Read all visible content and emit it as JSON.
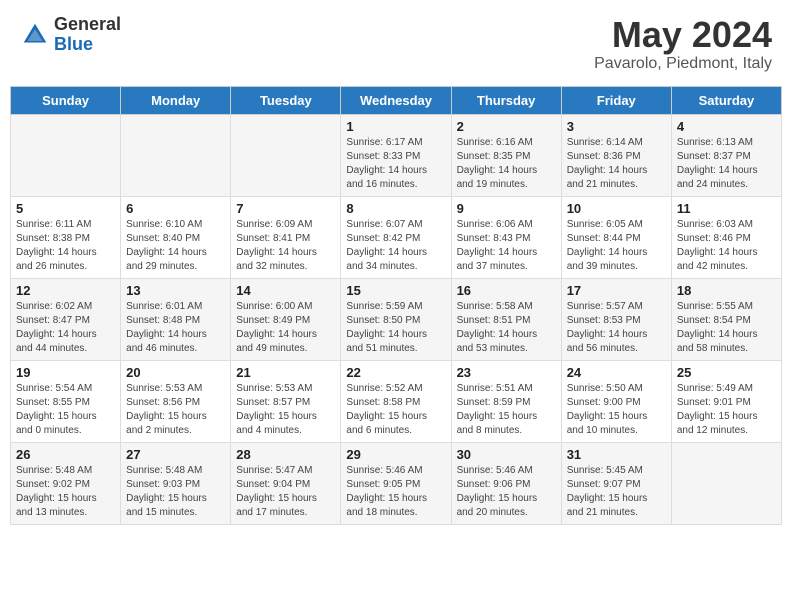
{
  "header": {
    "logo_general": "General",
    "logo_blue": "Blue",
    "month_title": "May 2024",
    "location": "Pavarolo, Piedmont, Italy"
  },
  "days_of_week": [
    "Sunday",
    "Monday",
    "Tuesday",
    "Wednesday",
    "Thursday",
    "Friday",
    "Saturday"
  ],
  "weeks": [
    [
      {
        "day": "",
        "info": ""
      },
      {
        "day": "",
        "info": ""
      },
      {
        "day": "",
        "info": ""
      },
      {
        "day": "1",
        "info": "Sunrise: 6:17 AM\nSunset: 8:33 PM\nDaylight: 14 hours\nand 16 minutes."
      },
      {
        "day": "2",
        "info": "Sunrise: 6:16 AM\nSunset: 8:35 PM\nDaylight: 14 hours\nand 19 minutes."
      },
      {
        "day": "3",
        "info": "Sunrise: 6:14 AM\nSunset: 8:36 PM\nDaylight: 14 hours\nand 21 minutes."
      },
      {
        "day": "4",
        "info": "Sunrise: 6:13 AM\nSunset: 8:37 PM\nDaylight: 14 hours\nand 24 minutes."
      }
    ],
    [
      {
        "day": "5",
        "info": "Sunrise: 6:11 AM\nSunset: 8:38 PM\nDaylight: 14 hours\nand 26 minutes."
      },
      {
        "day": "6",
        "info": "Sunrise: 6:10 AM\nSunset: 8:40 PM\nDaylight: 14 hours\nand 29 minutes."
      },
      {
        "day": "7",
        "info": "Sunrise: 6:09 AM\nSunset: 8:41 PM\nDaylight: 14 hours\nand 32 minutes."
      },
      {
        "day": "8",
        "info": "Sunrise: 6:07 AM\nSunset: 8:42 PM\nDaylight: 14 hours\nand 34 minutes."
      },
      {
        "day": "9",
        "info": "Sunrise: 6:06 AM\nSunset: 8:43 PM\nDaylight: 14 hours\nand 37 minutes."
      },
      {
        "day": "10",
        "info": "Sunrise: 6:05 AM\nSunset: 8:44 PM\nDaylight: 14 hours\nand 39 minutes."
      },
      {
        "day": "11",
        "info": "Sunrise: 6:03 AM\nSunset: 8:46 PM\nDaylight: 14 hours\nand 42 minutes."
      }
    ],
    [
      {
        "day": "12",
        "info": "Sunrise: 6:02 AM\nSunset: 8:47 PM\nDaylight: 14 hours\nand 44 minutes."
      },
      {
        "day": "13",
        "info": "Sunrise: 6:01 AM\nSunset: 8:48 PM\nDaylight: 14 hours\nand 46 minutes."
      },
      {
        "day": "14",
        "info": "Sunrise: 6:00 AM\nSunset: 8:49 PM\nDaylight: 14 hours\nand 49 minutes."
      },
      {
        "day": "15",
        "info": "Sunrise: 5:59 AM\nSunset: 8:50 PM\nDaylight: 14 hours\nand 51 minutes."
      },
      {
        "day": "16",
        "info": "Sunrise: 5:58 AM\nSunset: 8:51 PM\nDaylight: 14 hours\nand 53 minutes."
      },
      {
        "day": "17",
        "info": "Sunrise: 5:57 AM\nSunset: 8:53 PM\nDaylight: 14 hours\nand 56 minutes."
      },
      {
        "day": "18",
        "info": "Sunrise: 5:55 AM\nSunset: 8:54 PM\nDaylight: 14 hours\nand 58 minutes."
      }
    ],
    [
      {
        "day": "19",
        "info": "Sunrise: 5:54 AM\nSunset: 8:55 PM\nDaylight: 15 hours\nand 0 minutes."
      },
      {
        "day": "20",
        "info": "Sunrise: 5:53 AM\nSunset: 8:56 PM\nDaylight: 15 hours\nand 2 minutes."
      },
      {
        "day": "21",
        "info": "Sunrise: 5:53 AM\nSunset: 8:57 PM\nDaylight: 15 hours\nand 4 minutes."
      },
      {
        "day": "22",
        "info": "Sunrise: 5:52 AM\nSunset: 8:58 PM\nDaylight: 15 hours\nand 6 minutes."
      },
      {
        "day": "23",
        "info": "Sunrise: 5:51 AM\nSunset: 8:59 PM\nDaylight: 15 hours\nand 8 minutes."
      },
      {
        "day": "24",
        "info": "Sunrise: 5:50 AM\nSunset: 9:00 PM\nDaylight: 15 hours\nand 10 minutes."
      },
      {
        "day": "25",
        "info": "Sunrise: 5:49 AM\nSunset: 9:01 PM\nDaylight: 15 hours\nand 12 minutes."
      }
    ],
    [
      {
        "day": "26",
        "info": "Sunrise: 5:48 AM\nSunset: 9:02 PM\nDaylight: 15 hours\nand 13 minutes."
      },
      {
        "day": "27",
        "info": "Sunrise: 5:48 AM\nSunset: 9:03 PM\nDaylight: 15 hours\nand 15 minutes."
      },
      {
        "day": "28",
        "info": "Sunrise: 5:47 AM\nSunset: 9:04 PM\nDaylight: 15 hours\nand 17 minutes."
      },
      {
        "day": "29",
        "info": "Sunrise: 5:46 AM\nSunset: 9:05 PM\nDaylight: 15 hours\nand 18 minutes."
      },
      {
        "day": "30",
        "info": "Sunrise: 5:46 AM\nSunset: 9:06 PM\nDaylight: 15 hours\nand 20 minutes."
      },
      {
        "day": "31",
        "info": "Sunrise: 5:45 AM\nSunset: 9:07 PM\nDaylight: 15 hours\nand 21 minutes."
      },
      {
        "day": "",
        "info": ""
      }
    ]
  ]
}
